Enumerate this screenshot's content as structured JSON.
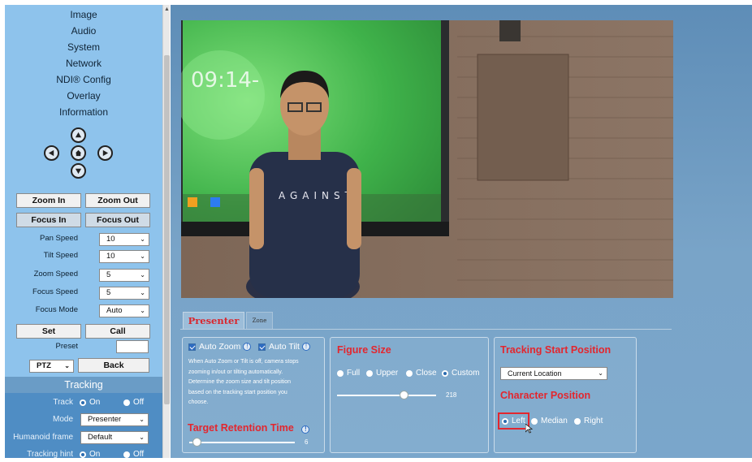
{
  "sidebar": {
    "menu": [
      "Image",
      "Audio",
      "System",
      "Network",
      "NDI® Config",
      "Overlay",
      "Information"
    ],
    "ptz": {
      "zoom_in": "Zoom In",
      "zoom_out": "Zoom Out",
      "focus_in": "Focus In",
      "focus_out": "Focus Out",
      "pan_speed_label": "Pan Speed",
      "pan_speed": "10",
      "tilt_speed_label": "Tilt Speed",
      "tilt_speed": "10",
      "zoom_speed_label": "Zoom Speed",
      "zoom_speed": "5",
      "focus_speed_label": "Focus Speed",
      "focus_speed": "5",
      "focus_mode_label": "Focus Mode",
      "focus_mode": "Auto",
      "set": "Set",
      "call": "Call",
      "preset_label": "Preset",
      "mode_select": "PTZ",
      "back": "Back"
    },
    "tracking": {
      "header": "Tracking",
      "track_label": "Track",
      "on": "On",
      "off": "Off",
      "mode_label": "Mode",
      "mode": "Presenter",
      "humanoid_label": "Humanoid frame",
      "humanoid": "Default",
      "hint_label": "Tracking hint"
    }
  },
  "tabs": {
    "presenter": "Presenter",
    "zone": "Zone"
  },
  "panel1": {
    "auto_zoom": "Auto Zoom",
    "auto_tilt": "Auto Tilt",
    "help_lines": [
      "When Auto Zoom or Tilt is off, camera stops",
      "zooming in/out or tilting automatically.",
      "Determine the zoom size and tilt position",
      "based on the tracking start position you",
      "choose."
    ],
    "retention_title": "Target Retention Time",
    "retention_value": "6",
    "retention_fraction": 0.07
  },
  "panel2": {
    "title": "Figure Size",
    "options": [
      "Full",
      "Upper",
      "Close",
      "Custom"
    ],
    "selected": "Custom",
    "value": "218",
    "fraction": 0.67
  },
  "panel3": {
    "title": "Tracking Start Position",
    "start_select": "Current Location",
    "char_title": "Character Position",
    "options": [
      "Left",
      "Median",
      "Right"
    ],
    "selected": "Left"
  },
  "video": {
    "clock": "09:14-",
    "shirt_text": "AGAINST"
  },
  "colors": {
    "sidebar": "#8ec3ec",
    "tracking": "#4f8dc4",
    "accent_red": "#e3262e",
    "main_bg": "#6e99c0"
  }
}
